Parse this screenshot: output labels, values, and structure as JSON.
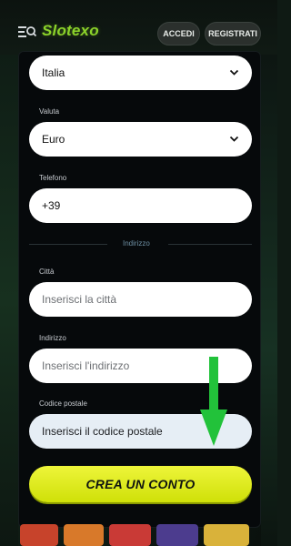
{
  "header": {
    "logo_text": "Slotexo",
    "login_label": "ACCEDI",
    "register_label": "REGISTRATI",
    "menu_icon": "menu-search-icon"
  },
  "form": {
    "country": {
      "value": "Italia"
    },
    "currency": {
      "label": "Valuta",
      "value": "Euro"
    },
    "phone": {
      "label": "Telefono",
      "value": "+39"
    },
    "address_section_title": "Indirizzo",
    "city": {
      "label": "Città",
      "placeholder": "Inserisci la città"
    },
    "address": {
      "label": "Indirizzo",
      "placeholder": "Inserisci l'indirizzo"
    },
    "postal_code": {
      "label": "Codice postale",
      "placeholder": "Inserisci il codice postale"
    },
    "submit_label": "CREA UN CONTO"
  },
  "colors": {
    "brand_green": "#8bd22a",
    "cta_yellow": "#e3ef1f",
    "annotation_arrow": "#22c23a"
  }
}
